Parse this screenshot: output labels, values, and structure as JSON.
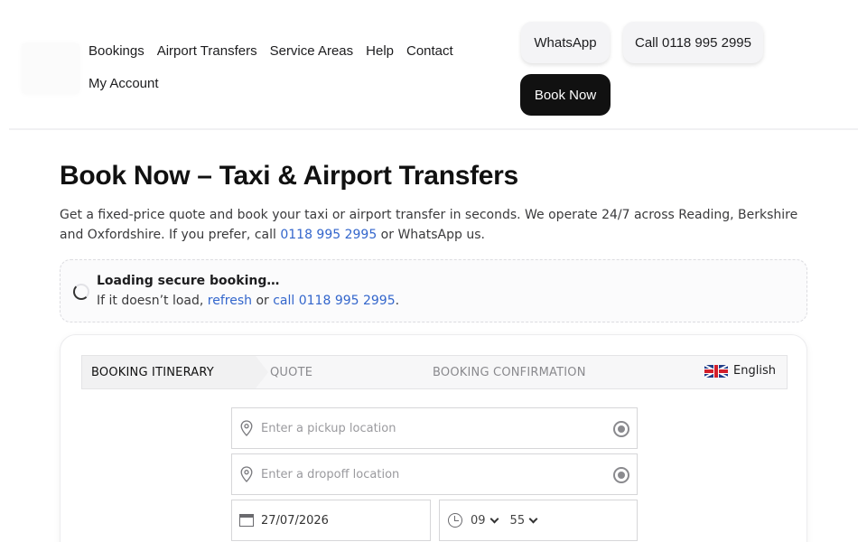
{
  "nav": {
    "links": [
      "Bookings",
      "Airport Transfers",
      "Service Areas",
      "Help",
      "Contact"
    ],
    "account": "My Account"
  },
  "actions": {
    "whatsapp": "WhatsApp",
    "call": "Call 0118 995 2995",
    "book_now": "Book Now"
  },
  "page": {
    "title": "Book Now – Taxi & Airport Transfers",
    "intro_before": "Get a fixed-price quote and book your taxi or airport transfer in seconds. We operate 24/7 across Reading, Berkshire and Oxfordshire. If you prefer, call ",
    "intro_phone": "0118 995 2995",
    "intro_after": " or WhatsApp us."
  },
  "notice": {
    "title": "Loading secure booking…",
    "text_before": "If it doesn’t load, ",
    "refresh": "refresh",
    "or": " or ",
    "call": "call 0118 995 2995",
    "end": "."
  },
  "booking": {
    "steps": [
      "BOOKING ITINERARY",
      "QUOTE",
      "BOOKING CONFIRMATION"
    ],
    "language": "English",
    "pickup_placeholder": "Enter a pickup location",
    "dropoff_placeholder": "Enter a dropoff location",
    "date": "27/07/2026",
    "hour": "09",
    "minute": "55"
  },
  "icons": {
    "pin": "map-pin-icon",
    "locate": "locate-icon",
    "calendar": "calendar-icon",
    "clock": "clock-icon"
  },
  "colors": {
    "link": "#3366cc",
    "primary_button": "#111111"
  }
}
